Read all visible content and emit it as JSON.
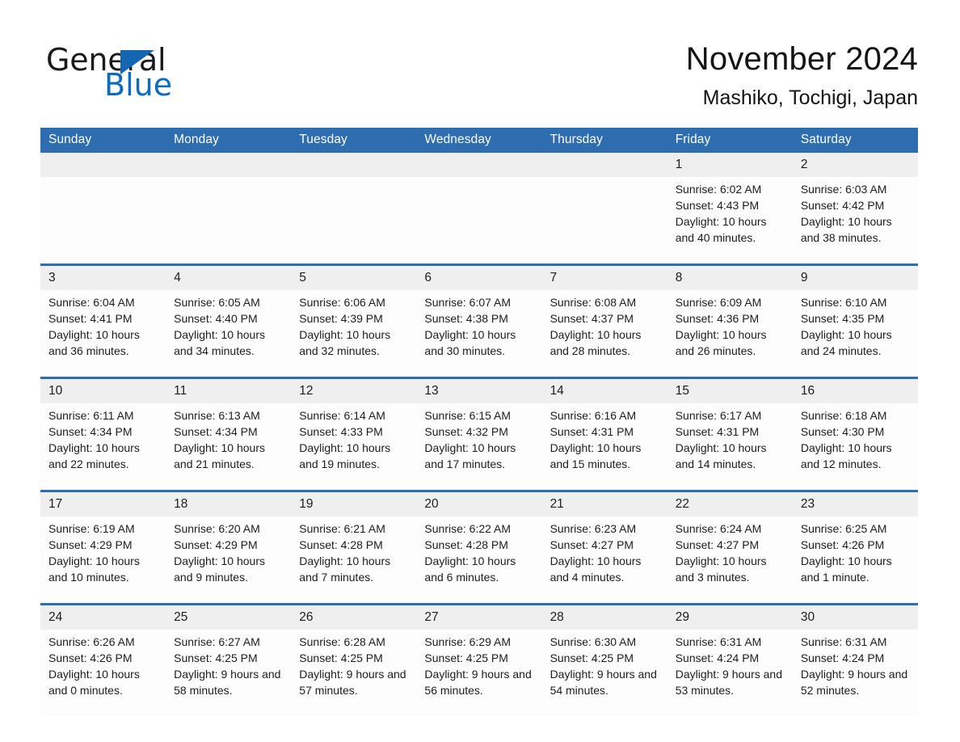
{
  "brand": {
    "logo_text_top": "General",
    "logo_text_bottom": "Blue",
    "logo_triangle_icon": "triangle-icon",
    "accent_blue": "#2e6daf",
    "logo_blue": "#0d6bbd"
  },
  "header": {
    "title": "November 2024",
    "subtitle": "Mashiko, Tochigi, Japan"
  },
  "calendar": {
    "weekday_headers": [
      "Sunday",
      "Monday",
      "Tuesday",
      "Wednesday",
      "Thursday",
      "Friday",
      "Saturday"
    ],
    "weeks": [
      {
        "days": [
          {
            "date": "",
            "sunrise": "",
            "sunset": "",
            "daylight": "",
            "empty": true
          },
          {
            "date": "",
            "sunrise": "",
            "sunset": "",
            "daylight": "",
            "empty": true
          },
          {
            "date": "",
            "sunrise": "",
            "sunset": "",
            "daylight": "",
            "empty": true
          },
          {
            "date": "",
            "sunrise": "",
            "sunset": "",
            "daylight": "",
            "empty": true
          },
          {
            "date": "",
            "sunrise": "",
            "sunset": "",
            "daylight": "",
            "empty": true
          },
          {
            "date": "1",
            "sunrise": "Sunrise: 6:02 AM",
            "sunset": "Sunset: 4:43 PM",
            "daylight": "Daylight: 10 hours and 40 minutes.",
            "empty": false
          },
          {
            "date": "2",
            "sunrise": "Sunrise: 6:03 AM",
            "sunset": "Sunset: 4:42 PM",
            "daylight": "Daylight: 10 hours and 38 minutes.",
            "empty": false
          }
        ]
      },
      {
        "days": [
          {
            "date": "3",
            "sunrise": "Sunrise: 6:04 AM",
            "sunset": "Sunset: 4:41 PM",
            "daylight": "Daylight: 10 hours and 36 minutes.",
            "empty": false
          },
          {
            "date": "4",
            "sunrise": "Sunrise: 6:05 AM",
            "sunset": "Sunset: 4:40 PM",
            "daylight": "Daylight: 10 hours and 34 minutes.",
            "empty": false
          },
          {
            "date": "5",
            "sunrise": "Sunrise: 6:06 AM",
            "sunset": "Sunset: 4:39 PM",
            "daylight": "Daylight: 10 hours and 32 minutes.",
            "empty": false
          },
          {
            "date": "6",
            "sunrise": "Sunrise: 6:07 AM",
            "sunset": "Sunset: 4:38 PM",
            "daylight": "Daylight: 10 hours and 30 minutes.",
            "empty": false
          },
          {
            "date": "7",
            "sunrise": "Sunrise: 6:08 AM",
            "sunset": "Sunset: 4:37 PM",
            "daylight": "Daylight: 10 hours and 28 minutes.",
            "empty": false
          },
          {
            "date": "8",
            "sunrise": "Sunrise: 6:09 AM",
            "sunset": "Sunset: 4:36 PM",
            "daylight": "Daylight: 10 hours and 26 minutes.",
            "empty": false
          },
          {
            "date": "9",
            "sunrise": "Sunrise: 6:10 AM",
            "sunset": "Sunset: 4:35 PM",
            "daylight": "Daylight: 10 hours and 24 minutes.",
            "empty": false
          }
        ]
      },
      {
        "days": [
          {
            "date": "10",
            "sunrise": "Sunrise: 6:11 AM",
            "sunset": "Sunset: 4:34 PM",
            "daylight": "Daylight: 10 hours and 22 minutes.",
            "empty": false
          },
          {
            "date": "11",
            "sunrise": "Sunrise: 6:13 AM",
            "sunset": "Sunset: 4:34 PM",
            "daylight": "Daylight: 10 hours and 21 minutes.",
            "empty": false
          },
          {
            "date": "12",
            "sunrise": "Sunrise: 6:14 AM",
            "sunset": "Sunset: 4:33 PM",
            "daylight": "Daylight: 10 hours and 19 minutes.",
            "empty": false
          },
          {
            "date": "13",
            "sunrise": "Sunrise: 6:15 AM",
            "sunset": "Sunset: 4:32 PM",
            "daylight": "Daylight: 10 hours and 17 minutes.",
            "empty": false
          },
          {
            "date": "14",
            "sunrise": "Sunrise: 6:16 AM",
            "sunset": "Sunset: 4:31 PM",
            "daylight": "Daylight: 10 hours and 15 minutes.",
            "empty": false
          },
          {
            "date": "15",
            "sunrise": "Sunrise: 6:17 AM",
            "sunset": "Sunset: 4:31 PM",
            "daylight": "Daylight: 10 hours and 14 minutes.",
            "empty": false
          },
          {
            "date": "16",
            "sunrise": "Sunrise: 6:18 AM",
            "sunset": "Sunset: 4:30 PM",
            "daylight": "Daylight: 10 hours and 12 minutes.",
            "empty": false
          }
        ]
      },
      {
        "days": [
          {
            "date": "17",
            "sunrise": "Sunrise: 6:19 AM",
            "sunset": "Sunset: 4:29 PM",
            "daylight": "Daylight: 10 hours and 10 minutes.",
            "empty": false
          },
          {
            "date": "18",
            "sunrise": "Sunrise: 6:20 AM",
            "sunset": "Sunset: 4:29 PM",
            "daylight": "Daylight: 10 hours and 9 minutes.",
            "empty": false
          },
          {
            "date": "19",
            "sunrise": "Sunrise: 6:21 AM",
            "sunset": "Sunset: 4:28 PM",
            "daylight": "Daylight: 10 hours and 7 minutes.",
            "empty": false
          },
          {
            "date": "20",
            "sunrise": "Sunrise: 6:22 AM",
            "sunset": "Sunset: 4:28 PM",
            "daylight": "Daylight: 10 hours and 6 minutes.",
            "empty": false
          },
          {
            "date": "21",
            "sunrise": "Sunrise: 6:23 AM",
            "sunset": "Sunset: 4:27 PM",
            "daylight": "Daylight: 10 hours and 4 minutes.",
            "empty": false
          },
          {
            "date": "22",
            "sunrise": "Sunrise: 6:24 AM",
            "sunset": "Sunset: 4:27 PM",
            "daylight": "Daylight: 10 hours and 3 minutes.",
            "empty": false
          },
          {
            "date": "23",
            "sunrise": "Sunrise: 6:25 AM",
            "sunset": "Sunset: 4:26 PM",
            "daylight": "Daylight: 10 hours and 1 minute.",
            "empty": false
          }
        ]
      },
      {
        "days": [
          {
            "date": "24",
            "sunrise": "Sunrise: 6:26 AM",
            "sunset": "Sunset: 4:26 PM",
            "daylight": "Daylight: 10 hours and 0 minutes.",
            "empty": false
          },
          {
            "date": "25",
            "sunrise": "Sunrise: 6:27 AM",
            "sunset": "Sunset: 4:25 PM",
            "daylight": "Daylight: 9 hours and 58 minutes.",
            "empty": false
          },
          {
            "date": "26",
            "sunrise": "Sunrise: 6:28 AM",
            "sunset": "Sunset: 4:25 PM",
            "daylight": "Daylight: 9 hours and 57 minutes.",
            "empty": false
          },
          {
            "date": "27",
            "sunrise": "Sunrise: 6:29 AM",
            "sunset": "Sunset: 4:25 PM",
            "daylight": "Daylight: 9 hours and 56 minutes.",
            "empty": false
          },
          {
            "date": "28",
            "sunrise": "Sunrise: 6:30 AM",
            "sunset": "Sunset: 4:25 PM",
            "daylight": "Daylight: 9 hours and 54 minutes.",
            "empty": false
          },
          {
            "date": "29",
            "sunrise": "Sunrise: 6:31 AM",
            "sunset": "Sunset: 4:24 PM",
            "daylight": "Daylight: 9 hours and 53 minutes.",
            "empty": false
          },
          {
            "date": "30",
            "sunrise": "Sunrise: 6:31 AM",
            "sunset": "Sunset: 4:24 PM",
            "daylight": "Daylight: 9 hours and 52 minutes.",
            "empty": false
          }
        ]
      }
    ]
  }
}
